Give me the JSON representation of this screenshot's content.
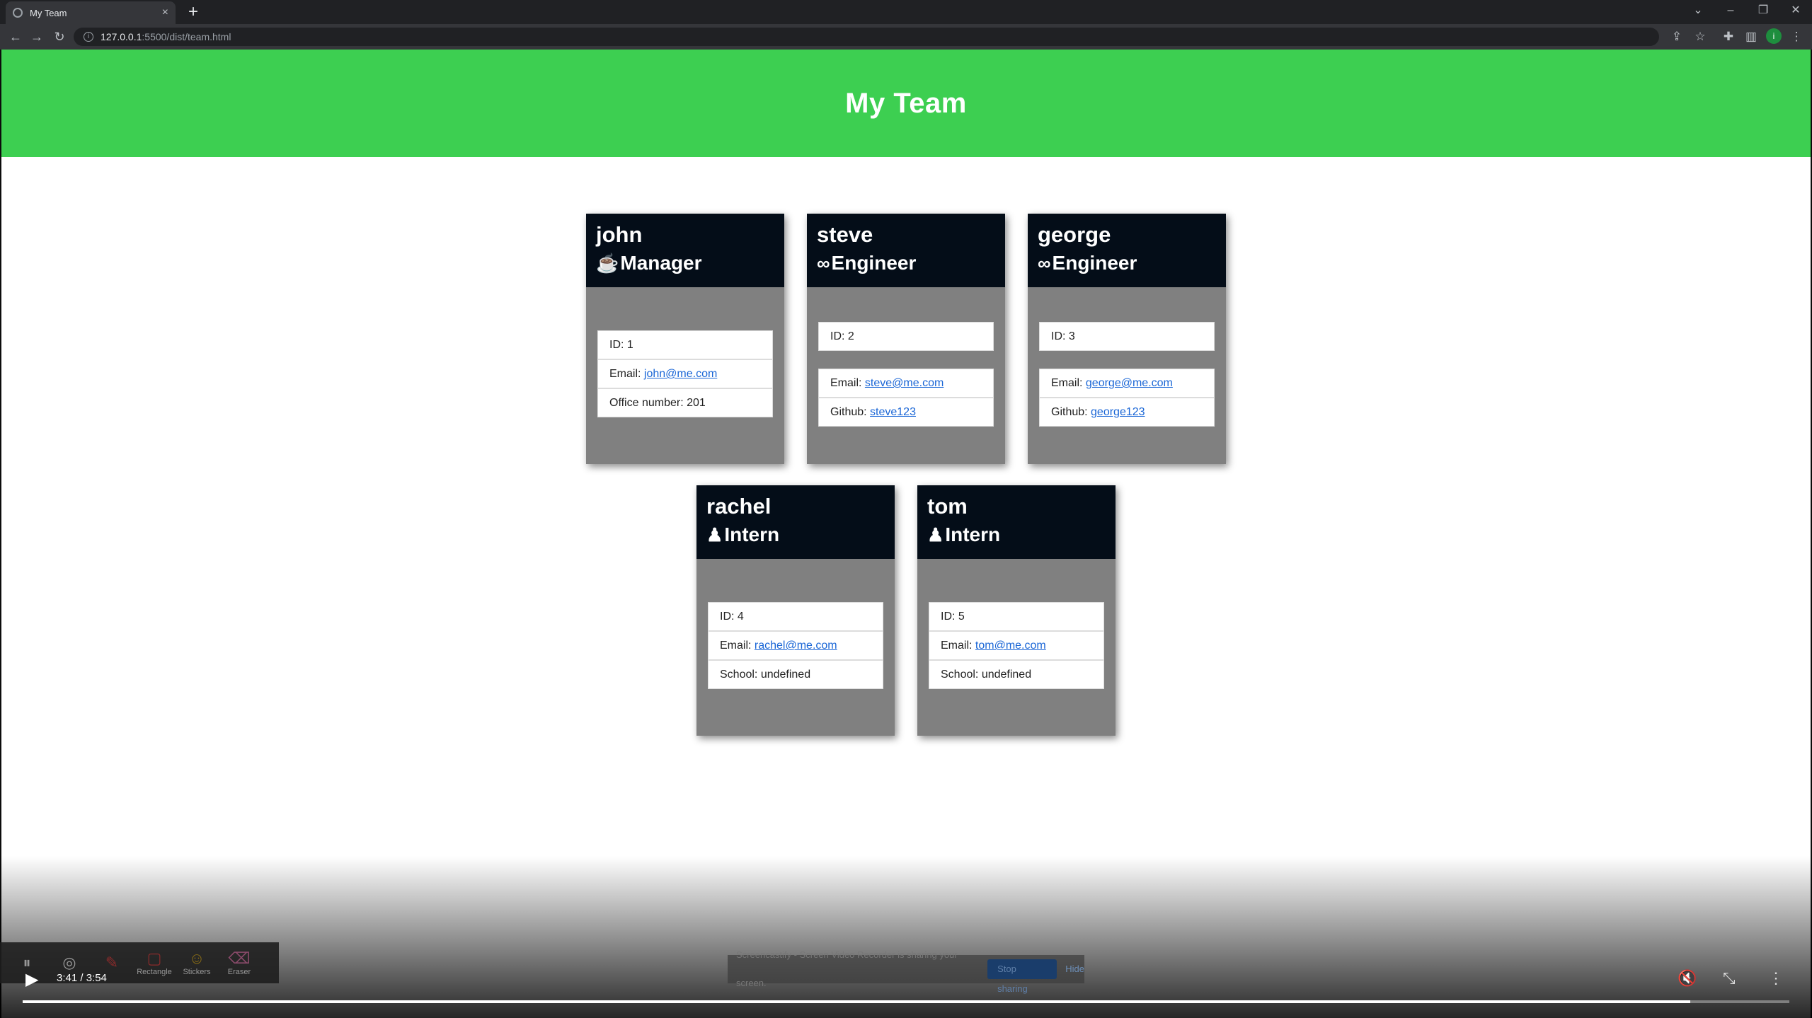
{
  "browser": {
    "tab_title": "My Team",
    "url_host": "127.0.0.1",
    "url_path": ":5500/dist/team.html",
    "profile_initial": "i"
  },
  "page": {
    "heading": "My Team",
    "cards": [
      {
        "name": "john",
        "role_icon": "coffee-icon",
        "role": "Manager",
        "id": "ID: 1",
        "email_label": "Email: ",
        "email": "john@me.com",
        "extra_label": "Office number: ",
        "extra": "201"
      },
      {
        "name": "steve",
        "role_icon": "glasses-icon",
        "role": "Engineer",
        "id": "ID: 2",
        "email_label": "Email: ",
        "email": "steve@me.com",
        "extra_label": "Github: ",
        "extra": "steve123"
      },
      {
        "name": "george",
        "role_icon": "glasses-icon",
        "role": "Engineer",
        "id": "ID: 3",
        "email_label": "Email: ",
        "email": "george@me.com",
        "extra_label": "Github: ",
        "extra": "george123"
      },
      {
        "name": "rachel",
        "role_icon": "graduate-icon",
        "role": "Intern",
        "id": "ID: 4",
        "email_label": "Email: ",
        "email": "rachel@me.com",
        "extra_label": "School: ",
        "extra": "undefined"
      },
      {
        "name": "tom",
        "role_icon": "graduate-icon",
        "role": "Intern",
        "id": "ID: 5",
        "email_label": "Email: ",
        "email": "tom@me.com",
        "extra_label": "School: ",
        "extra": "undefined"
      }
    ]
  },
  "video": {
    "time": "3:41 / 3:54",
    "progress": 0.944,
    "recorder_tools": [
      "Rectangle",
      "Stickers",
      "Eraser"
    ],
    "share_text": "Screencastify - Screen Video Recorder is sharing your screen.",
    "stop_label": "Stop sharing",
    "hide_label": "Hide"
  },
  "colors": {
    "header_green": "#3dcf51",
    "card_head": "#040d18",
    "card_body": "#808080",
    "link": "#1a66d6"
  }
}
